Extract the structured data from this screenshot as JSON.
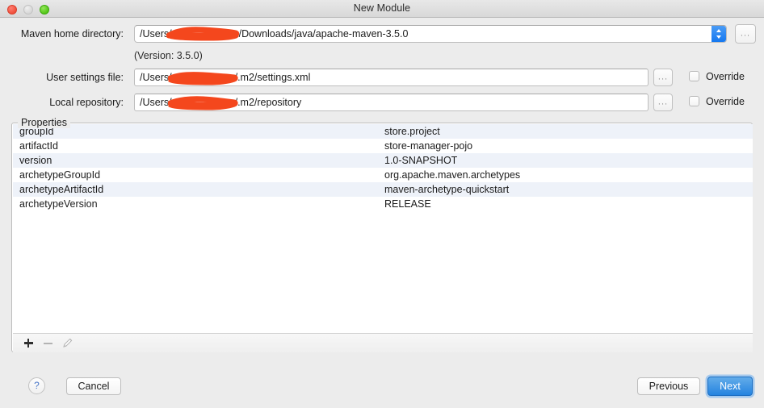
{
  "window": {
    "title": "New Module",
    "traffic_lights": [
      "close",
      "minimize",
      "maximize"
    ]
  },
  "form": {
    "maven_home": {
      "label": "Maven home directory:",
      "value": "/Users/████████/Downloads/java/apache-maven-3.5.0",
      "value_prefix": "/Users/",
      "value_suffix": "/Downloads/java/apache-maven-3.5.0",
      "browse_label": "...",
      "version_note": "(Version: 3.5.0)"
    },
    "user_settings": {
      "label": "User settings file:",
      "value_prefix": "/Users/",
      "value_suffix": "/.m2/settings.xml",
      "browse_label": "...",
      "override_label": "Override",
      "override_checked": false
    },
    "local_repository": {
      "label": "Local repository:",
      "value_prefix": "/Users/",
      "value_suffix": "/.m2/repository",
      "browse_label": "...",
      "override_label": "Override",
      "override_checked": false
    }
  },
  "properties": {
    "legend": "Properties",
    "rows": [
      {
        "key": "groupId",
        "value": "store.project"
      },
      {
        "key": "artifactId",
        "value": "store-manager-pojo"
      },
      {
        "key": "version",
        "value": "1.0-SNAPSHOT"
      },
      {
        "key": "archetypeGroupId",
        "value": "org.apache.maven.archetypes"
      },
      {
        "key": "archetypeArtifactId",
        "value": "maven-archetype-quickstart"
      },
      {
        "key": "archetypeVersion",
        "value": "RELEASE"
      }
    ],
    "toolbar": {
      "add_icon": "plus-icon",
      "remove_icon": "minus-icon",
      "edit_icon": "pencil-icon"
    }
  },
  "footer": {
    "help_label": "?",
    "cancel_label": "Cancel",
    "previous_label": "Previous",
    "next_label": "Next"
  },
  "colors": {
    "accent_blue": "#2483e0",
    "redaction": "#f4471d",
    "row_alt": "#eef2f9",
    "window_bg": "#ececec"
  }
}
